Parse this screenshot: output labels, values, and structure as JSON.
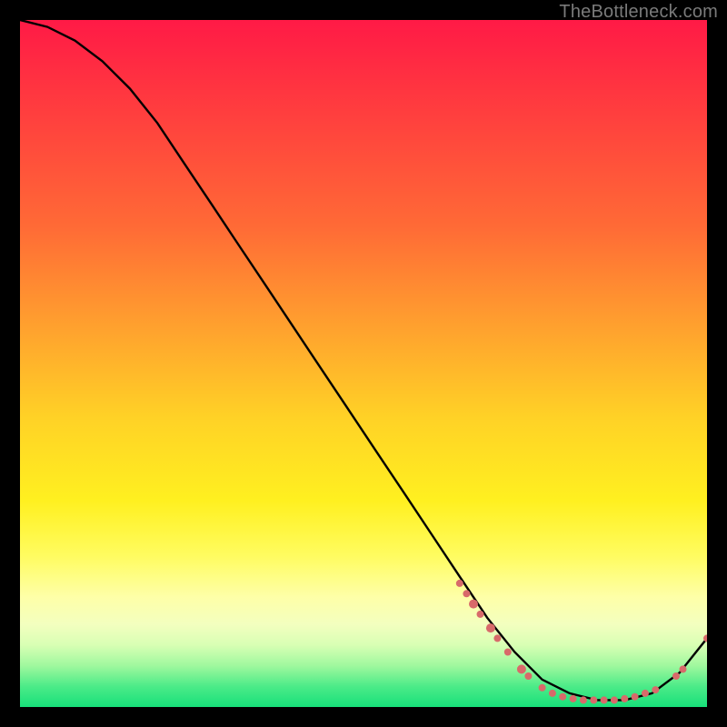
{
  "attribution": "TheBottleneck.com",
  "chart_data": {
    "type": "line",
    "title": "",
    "xlabel": "",
    "ylabel": "",
    "xlim": [
      0,
      100
    ],
    "ylim": [
      0,
      100
    ],
    "series": [
      {
        "name": "curve",
        "x": [
          0,
          4,
          8,
          12,
          16,
          20,
          24,
          28,
          32,
          36,
          40,
          44,
          48,
          52,
          56,
          60,
          64,
          68,
          72,
          76,
          80,
          84,
          88,
          92,
          96,
          100
        ],
        "y": [
          100,
          99,
          97,
          94,
          90,
          85,
          79,
          73,
          67,
          61,
          55,
          49,
          43,
          37,
          31,
          25,
          19,
          13,
          8,
          4,
          2,
          1,
          1,
          2,
          5,
          10
        ]
      }
    ],
    "markers": [
      {
        "x": 64.0,
        "y": 18.0,
        "r": 4
      },
      {
        "x": 65.0,
        "y": 16.5,
        "r": 4
      },
      {
        "x": 66.0,
        "y": 15.0,
        "r": 5
      },
      {
        "x": 67.0,
        "y": 13.5,
        "r": 4
      },
      {
        "x": 68.5,
        "y": 11.5,
        "r": 5
      },
      {
        "x": 69.5,
        "y": 10.0,
        "r": 4
      },
      {
        "x": 71.0,
        "y": 8.0,
        "r": 4
      },
      {
        "x": 73.0,
        "y": 5.5,
        "r": 5
      },
      {
        "x": 74.0,
        "y": 4.5,
        "r": 4
      },
      {
        "x": 76.0,
        "y": 2.8,
        "r": 4
      },
      {
        "x": 77.5,
        "y": 2.0,
        "r": 4
      },
      {
        "x": 79.0,
        "y": 1.5,
        "r": 4
      },
      {
        "x": 80.5,
        "y": 1.2,
        "r": 4
      },
      {
        "x": 82.0,
        "y": 1.0,
        "r": 4
      },
      {
        "x": 83.5,
        "y": 1.0,
        "r": 4
      },
      {
        "x": 85.0,
        "y": 1.0,
        "r": 4
      },
      {
        "x": 86.5,
        "y": 1.0,
        "r": 4
      },
      {
        "x": 88.0,
        "y": 1.2,
        "r": 4
      },
      {
        "x": 89.5,
        "y": 1.5,
        "r": 4
      },
      {
        "x": 91.0,
        "y": 2.0,
        "r": 4
      },
      {
        "x": 92.5,
        "y": 2.5,
        "r": 4
      },
      {
        "x": 95.5,
        "y": 4.5,
        "r": 4
      },
      {
        "x": 96.5,
        "y": 5.5,
        "r": 4
      },
      {
        "x": 100.0,
        "y": 10.0,
        "r": 4
      }
    ],
    "marker_color": "#d86a6a",
    "curve_color": "#000000"
  }
}
